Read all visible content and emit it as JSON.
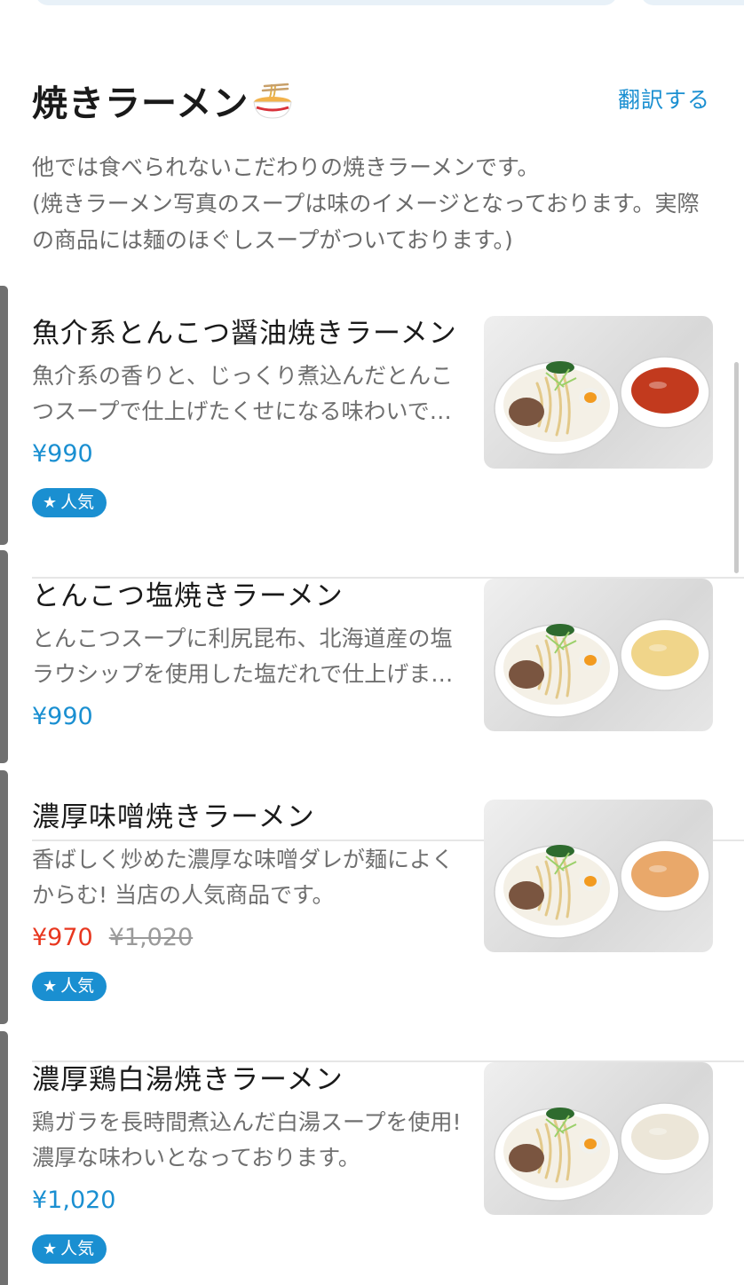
{
  "header": {
    "title": "焼きラーメン",
    "translate_label": "翻訳する",
    "description": "他では食べられないこだわりの焼きラーメンです。\n(焼きラーメン写真のスープは味のイメージとなっております。実際の商品には麺のほぐしスープがついております。)"
  },
  "items": [
    {
      "name": "魚介系とんこつ醤油焼きラーメン",
      "description": "魚介系の香りと、じっくり煮込んだとんこつスープで仕上げたくせになる味わいです。",
      "price": "¥990",
      "badge": "人気",
      "soup_color": "#c23a1e"
    },
    {
      "name": "とんこつ塩焼きラーメン",
      "description": "とんこつスープに利尻昆布、北海道産の塩ラウシップを使用した塩だれで仕上げました。",
      "price": "¥990",
      "soup_color": "#f0d58a"
    },
    {
      "name": "濃厚味噌焼きラーメン",
      "description": "香ばしく炒めた濃厚な味噌ダレが麺によくからむ! 当店の人気商品です。",
      "price": "¥970",
      "original_price": "¥1,020",
      "badge": "人気",
      "soup_color": "#e9a86a"
    },
    {
      "name": "濃厚鶏白湯焼きラーメン",
      "description": "鶏ガラを長時間煮込んだ白湯スープを使用! 濃厚な味わいとなっております。",
      "price": "¥1,020",
      "badge": "人気",
      "soup_color": "#ece6d8"
    }
  ],
  "colors": {
    "accent": "#1a8fd1",
    "sale": "#e8371f"
  },
  "icons": {
    "title_icon": "ramen-bowl-icon",
    "badge_icon": "star-icon"
  }
}
